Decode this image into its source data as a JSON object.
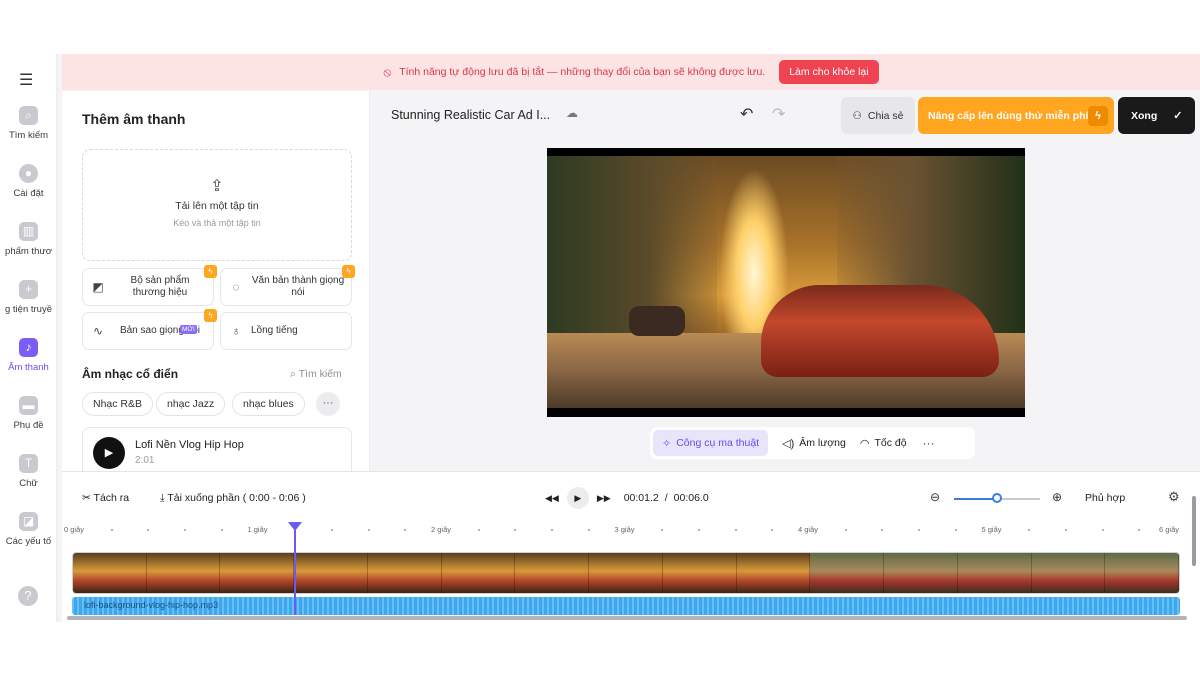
{
  "rail": {
    "menu_icon": "hamburger-icon",
    "items": [
      {
        "label": "Tìm kiếm",
        "icon": "search-icon"
      },
      {
        "label": "Cài đặt",
        "icon": "settings-icon"
      },
      {
        "label": "phẩm thươ",
        "icon": "brand-kit-icon"
      },
      {
        "label": "g tiện truyề",
        "icon": "media-plus-icon"
      },
      {
        "label": "Âm thanh",
        "icon": "music-note-icon",
        "active": true
      },
      {
        "label": "Phụ đề",
        "icon": "subtitles-icon"
      },
      {
        "label": "Chữ",
        "icon": "text-icon"
      },
      {
        "label": "Các yếu tố",
        "icon": "elements-icon"
      }
    ],
    "help_icon": "help-icon"
  },
  "banner": {
    "message": "Tính năng tự động lưu đã bị tắt — những thay đổi của bạn sẽ không được lưu.",
    "button": "Làm cho khỏe lại",
    "color": "#ef4352"
  },
  "panel": {
    "title": "Thêm âm thanh",
    "upload": {
      "title": "Tải lên một tập tin",
      "subtitle": "Kéo và thả một tập tin"
    },
    "tools": [
      {
        "label": "Bộ sản phẩm thương hiệu",
        "badge": "bolt"
      },
      {
        "label": "Văn bản thành giọng nói",
        "badge": "bolt"
      },
      {
        "label": "Bản sao giọng nói",
        "badge": "bolt",
        "new": "MỚI"
      },
      {
        "label": "Lồng tiếng"
      }
    ],
    "section_title": "Âm nhạc cổ điển",
    "section_search": "Tìm kiếm",
    "chips": [
      "Nhạc R&B",
      "nhạc Jazz",
      "nhạc blues"
    ],
    "track": {
      "title": "Lofi Nền Vlog Hip Hop",
      "duration": "2:01"
    }
  },
  "topbar": {
    "project_title": "Stunning Realistic Car Ad I...",
    "share": "Chia sẻ",
    "upgrade": "Nâng cấp lên dùng thử miễn phí",
    "done": "Xong",
    "accent": "#ffa51f"
  },
  "video_controls": {
    "magic": "Công cụ ma thuật",
    "volume": "Âm lượng",
    "speed": "Tốc độ"
  },
  "timeline": {
    "split": "Tách ra",
    "download": "Tải xuống phần",
    "range": "( 0:00 - 0:06 )",
    "current_time": "00:01.2",
    "separator": "/",
    "total_time": "00:06.0",
    "fit": "Phủ hợp",
    "zoom_level": 0.5,
    "ruler": [
      "0 giây",
      "1 giây",
      "2 giây",
      "3 giây",
      "4 giây",
      "5 giây",
      "6 giây"
    ],
    "audio_clip": "lofi-background-vlog-hip-hop.mp3",
    "playhead_seconds": 1.2
  }
}
